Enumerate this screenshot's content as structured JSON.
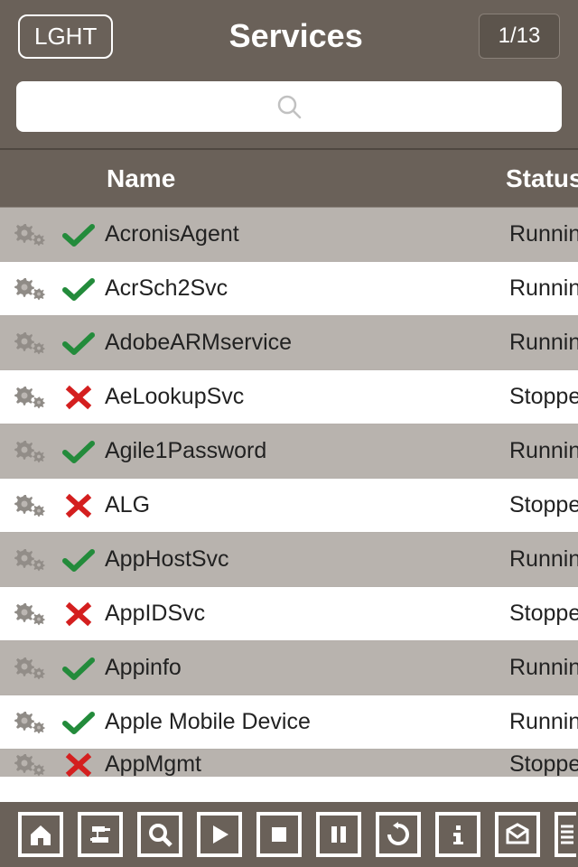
{
  "header": {
    "theme_button": "LGHT",
    "title": "Services",
    "page_indicator": "1/13"
  },
  "search": {
    "placeholder": ""
  },
  "columns": {
    "name": "Name",
    "status": "Status"
  },
  "services": [
    {
      "name": "AcronisAgent",
      "status": "Running",
      "running": true
    },
    {
      "name": "AcrSch2Svc",
      "status": "Running",
      "running": true
    },
    {
      "name": "AdobeARMservice",
      "status": "Running",
      "running": true
    },
    {
      "name": "AeLookupSvc",
      "status": "Stopped",
      "running": false
    },
    {
      "name": "Agile1Password",
      "status": "Running",
      "running": true
    },
    {
      "name": "ALG",
      "status": "Stopped",
      "running": false
    },
    {
      "name": "AppHostSvc",
      "status": "Running",
      "running": true
    },
    {
      "name": "AppIDSvc",
      "status": "Stopped",
      "running": false
    },
    {
      "name": "Appinfo",
      "status": "Running",
      "running": true
    },
    {
      "name": "Apple Mobile Device",
      "status": "Running",
      "running": true
    },
    {
      "name": "AppMgmt",
      "status": "Stopped",
      "running": false
    }
  ],
  "toolbar": [
    "home",
    "connect",
    "search",
    "play",
    "stop",
    "pause",
    "restart",
    "info",
    "mail",
    "more"
  ]
}
